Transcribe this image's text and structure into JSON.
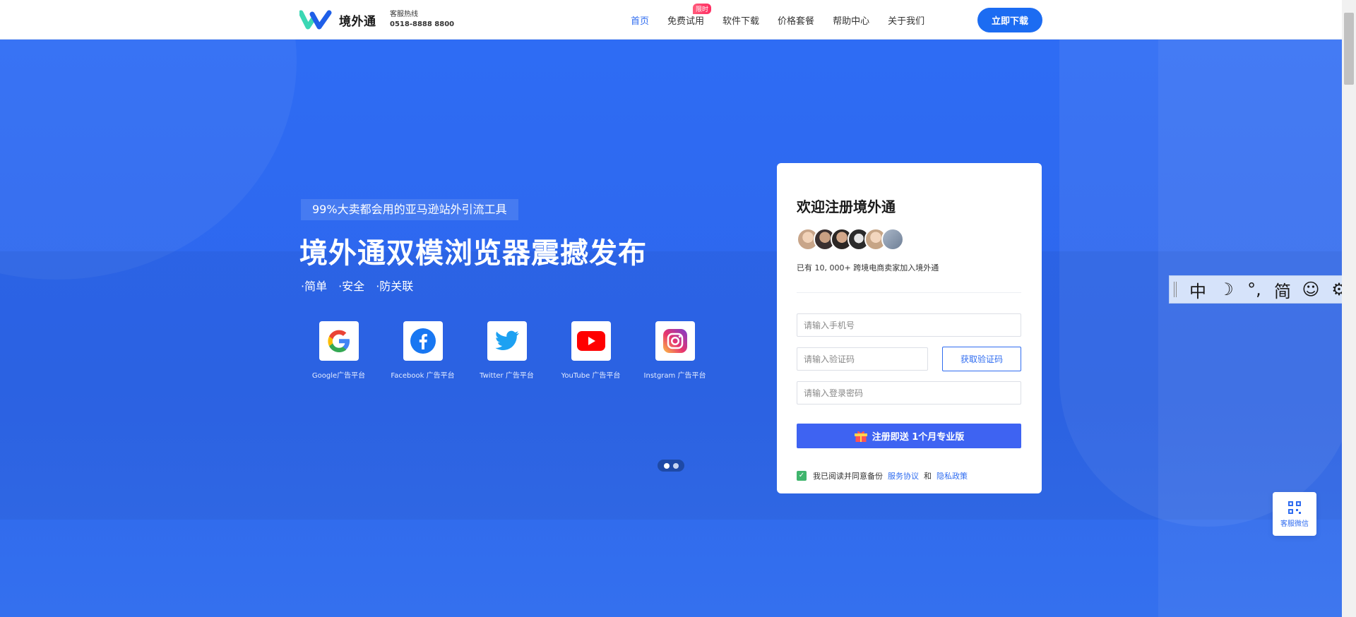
{
  "header": {
    "logo_text": "境外通",
    "hotline_label": "客服热线",
    "hotline_number": "0518-8888 8800",
    "nav": [
      {
        "label": "首页",
        "active": true
      },
      {
        "label": "免费试用",
        "badge": "限时"
      },
      {
        "label": "软件下载"
      },
      {
        "label": "价格套餐"
      },
      {
        "label": "帮助中心"
      },
      {
        "label": "关于我们"
      }
    ],
    "download_label": "立即下载"
  },
  "hero": {
    "tagline": "99%大卖都会用的亚马逊站外引流工具",
    "headline": "境外通双模浏览器震撼发布",
    "features": [
      "·简单",
      "·安全",
      "·防关联"
    ],
    "platforms": [
      {
        "label": "Google广告平台",
        "icon": "google-icon"
      },
      {
        "label": "Facebook 广告平台",
        "icon": "facebook-icon"
      },
      {
        "label": "Twitter 广告平台",
        "icon": "twitter-icon"
      },
      {
        "label": "YouTube 广告平台",
        "icon": "youtube-icon"
      },
      {
        "label": "Instgram 广告平台",
        "icon": "instagram-icon"
      }
    ]
  },
  "register": {
    "title": "欢迎注册境外通",
    "join_text": "已有 10, 000+ 跨境电商卖家加入境外通",
    "phone_placeholder": "请输入手机号",
    "code_placeholder": "请输入验证码",
    "get_code_label": "获取验证码",
    "password_placeholder": "请输入登录密码",
    "submit_label": "注册即送 1个月专业版",
    "agree_text": "我已阅读并同意备份",
    "service_link": "服务协议",
    "and_text": "和",
    "privacy_link": "隐私政策"
  },
  "ime": {
    "items": [
      "中",
      "☽",
      "°,",
      "简",
      "☺",
      "⚙"
    ]
  },
  "customer_service": {
    "label": "客服微信"
  },
  "colors": {
    "primary": "#2f6cf0",
    "submit": "#3e63f2",
    "check": "#3fb56d"
  }
}
